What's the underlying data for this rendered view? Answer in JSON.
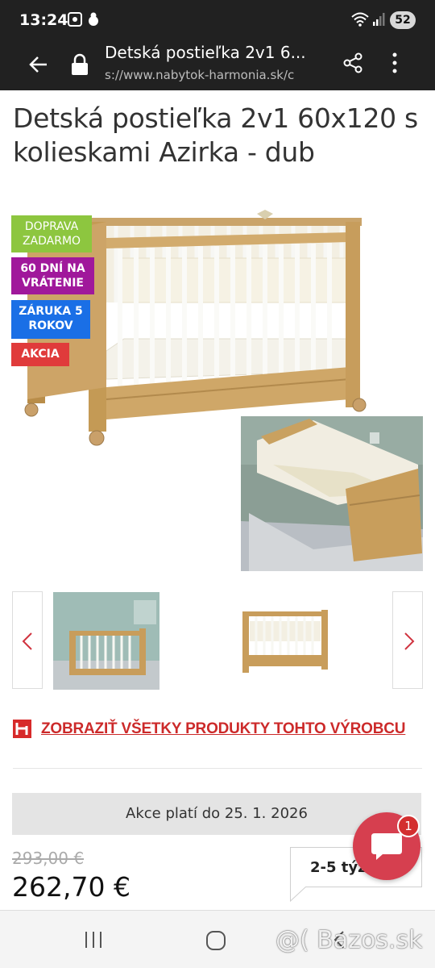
{
  "status_bar": {
    "time": "13:24",
    "battery": "52",
    "icons": [
      "screenshot-icon",
      "notification-icon",
      "wifi-icon",
      "signal-icon"
    ]
  },
  "browser": {
    "page_title": "Detská postieľka 2v1 6...",
    "url": "s://www.nabytok-harmonia.sk/c",
    "icons": [
      "back-arrow-icon",
      "lock-icon",
      "share-icon",
      "more-menu-icon"
    ]
  },
  "product": {
    "title": "Detská postieľka 2v1 60x120 s kolieskami Azirka - dub",
    "badges": {
      "free_shipping": "DOPRAVA ZADARMO",
      "return": "60 DNÍ NA VRÁTENIE",
      "warranty": "ZÁRUKA 5 ROKOV",
      "sale": "AKCIA"
    },
    "manufacturer_link": "ZOBRAZIŤ VŠETKY PRODUKTY TOHTO VÝROBCU",
    "promo": "Akce platí do 25. 1. 2026",
    "old_price": "293,00 €",
    "price": "262,70 €",
    "delivery": "2-5 týž"
  },
  "chat": {
    "badge_count": "1"
  },
  "watermark": "@( Bazos.sk",
  "colors": {
    "badge_green": "#8dc63f",
    "badge_purple": "#a0189b",
    "badge_blue": "#1a6fe6",
    "badge_red": "#e03b3b",
    "link_red": "#cc2a2a",
    "chat_red": "#d63f4f"
  }
}
